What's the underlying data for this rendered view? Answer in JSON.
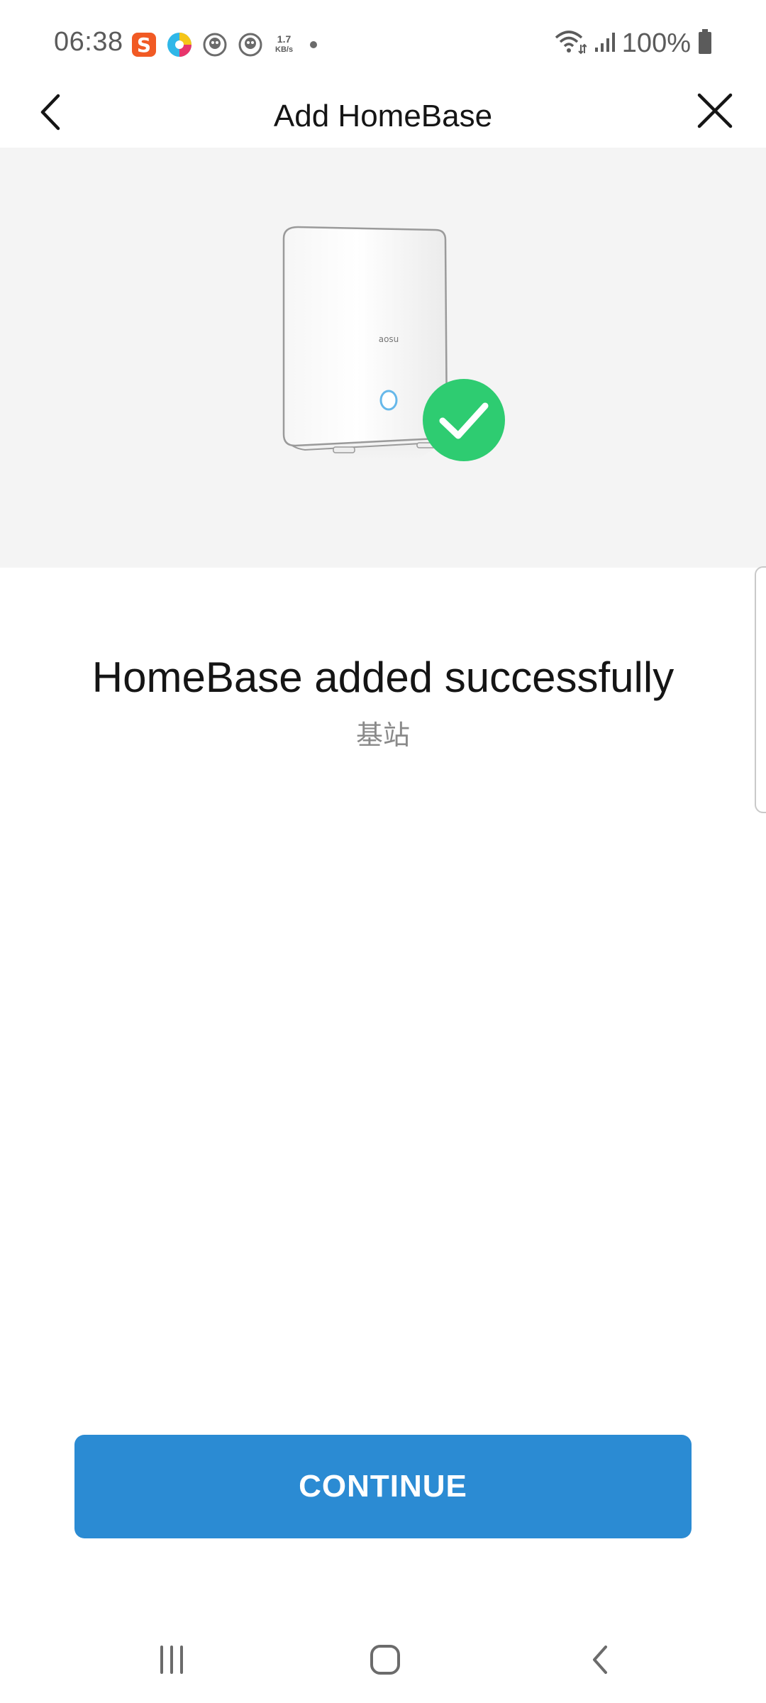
{
  "status_bar": {
    "time": "06:38",
    "net_speed_value": "1.7",
    "net_speed_unit": "KB/s",
    "battery": "100%",
    "icons": [
      "sogou-app-icon",
      "browser-app-icon",
      "game-app-icon",
      "game-app-icon",
      "wifi-icon",
      "signal-icon",
      "battery-icon"
    ]
  },
  "header": {
    "title": "Add HomeBase",
    "back_icon": "chevron-left-icon",
    "close_icon": "close-icon"
  },
  "hero": {
    "device_brand": "aosu",
    "status_icon": "check-circle-icon",
    "colors": {
      "background": "#f4f4f4",
      "success": "#2ecc71"
    }
  },
  "message": {
    "title": "HomeBase added successfully",
    "device_name": "基站"
  },
  "continue_button": {
    "label": "CONTINUE",
    "color": "#2b8bd3"
  },
  "nav_bar": {
    "icons": [
      "recent-apps-icon",
      "home-icon",
      "back-icon"
    ]
  }
}
